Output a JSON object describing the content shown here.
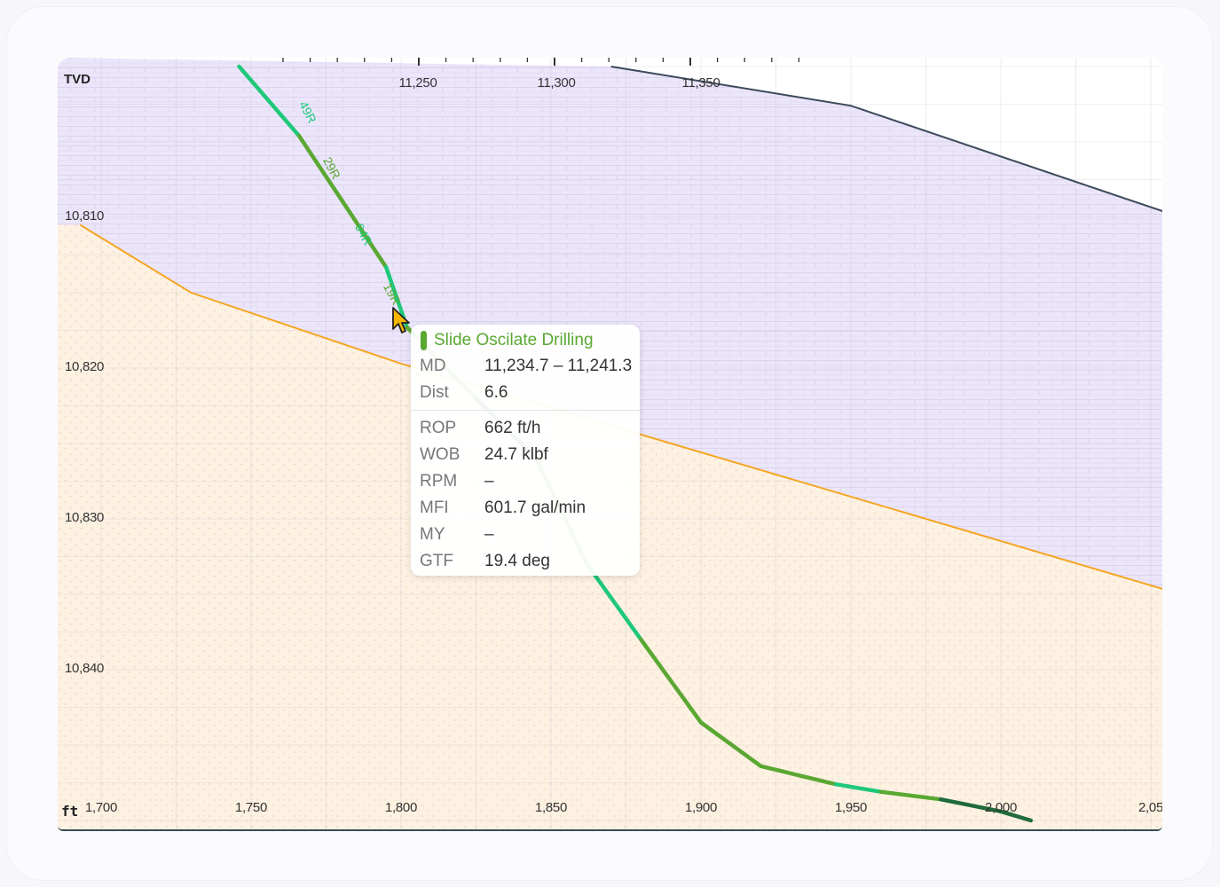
{
  "chart_data": {
    "type": "line",
    "x_axis_unit": "ft",
    "x_ticks": [
      "1,700",
      "1,750",
      "1,800",
      "1,850",
      "1,900",
      "1,950",
      "2,000",
      "2,05"
    ],
    "y_axis_title": "TVD",
    "y_ticks": [
      "10,810",
      "10,820",
      "10,830",
      "10,840"
    ],
    "md_ticks": [
      "11,250",
      "11,300",
      "11,350"
    ],
    "segment_labels": [
      "49R",
      "29R",
      "94R",
      "19R"
    ],
    "series": [
      {
        "name": "",
        "color": "#f5a623",
        "points": [
          [
            1693,
            10810.5
          ],
          [
            1730,
            10815.0
          ],
          [
            1800,
            10819.7
          ],
          [
            2060,
            10835.0
          ]
        ]
      },
      {
        "name": "",
        "color": "#3b4a5a",
        "points": [
          [
            1870,
            10800.0
          ],
          [
            1950,
            10802.6
          ],
          [
            2060,
            10810.0
          ]
        ]
      },
      {
        "name": "",
        "color": "#5aa832",
        "points": [
          [
            1746,
            10800.0
          ],
          [
            1766,
            10804.6
          ],
          [
            1782,
            10809.4
          ],
          [
            1795,
            10813.3
          ],
          [
            1802,
            10817.3
          ],
          [
            1825,
            10822.0
          ],
          [
            1845,
            10826.0
          ],
          [
            1862,
            10833.0
          ],
          [
            1880,
            10838.0
          ],
          [
            1900,
            10843.5
          ],
          [
            1920,
            10846.4
          ],
          [
            1945,
            10847.6
          ],
          [
            1960,
            10848.1
          ],
          [
            1980,
            10848.6
          ],
          [
            2000,
            10849.4
          ],
          [
            2010,
            10850.0
          ]
        ]
      }
    ]
  },
  "tooltip": {
    "title": "Slide Oscilate Drilling",
    "color": "#5aa832",
    "rows_top": [
      {
        "key": "MD",
        "value": "11,234.7 – 11,241.3"
      },
      {
        "key": "Dist",
        "value": "6.6"
      }
    ],
    "rows_bottom": [
      {
        "key": "ROP",
        "value": "662 ft/h"
      },
      {
        "key": "WOB",
        "value": "24.7 klbf"
      },
      {
        "key": "RPM",
        "value": "–"
      },
      {
        "key": "MFI",
        "value": "601.7 gal/min"
      },
      {
        "key": "MY",
        "value": "–"
      },
      {
        "key": "GTF",
        "value": "19.4 deg"
      }
    ]
  },
  "colors": {
    "upper_zone": "#ece6fb",
    "lower_zone": "#fdf1e2",
    "target_line": "#f5a623",
    "top_line": "#3b4a5a",
    "slide": "#5aa832",
    "rotate": "#1ec97a",
    "dark": "#1f6b3a"
  }
}
